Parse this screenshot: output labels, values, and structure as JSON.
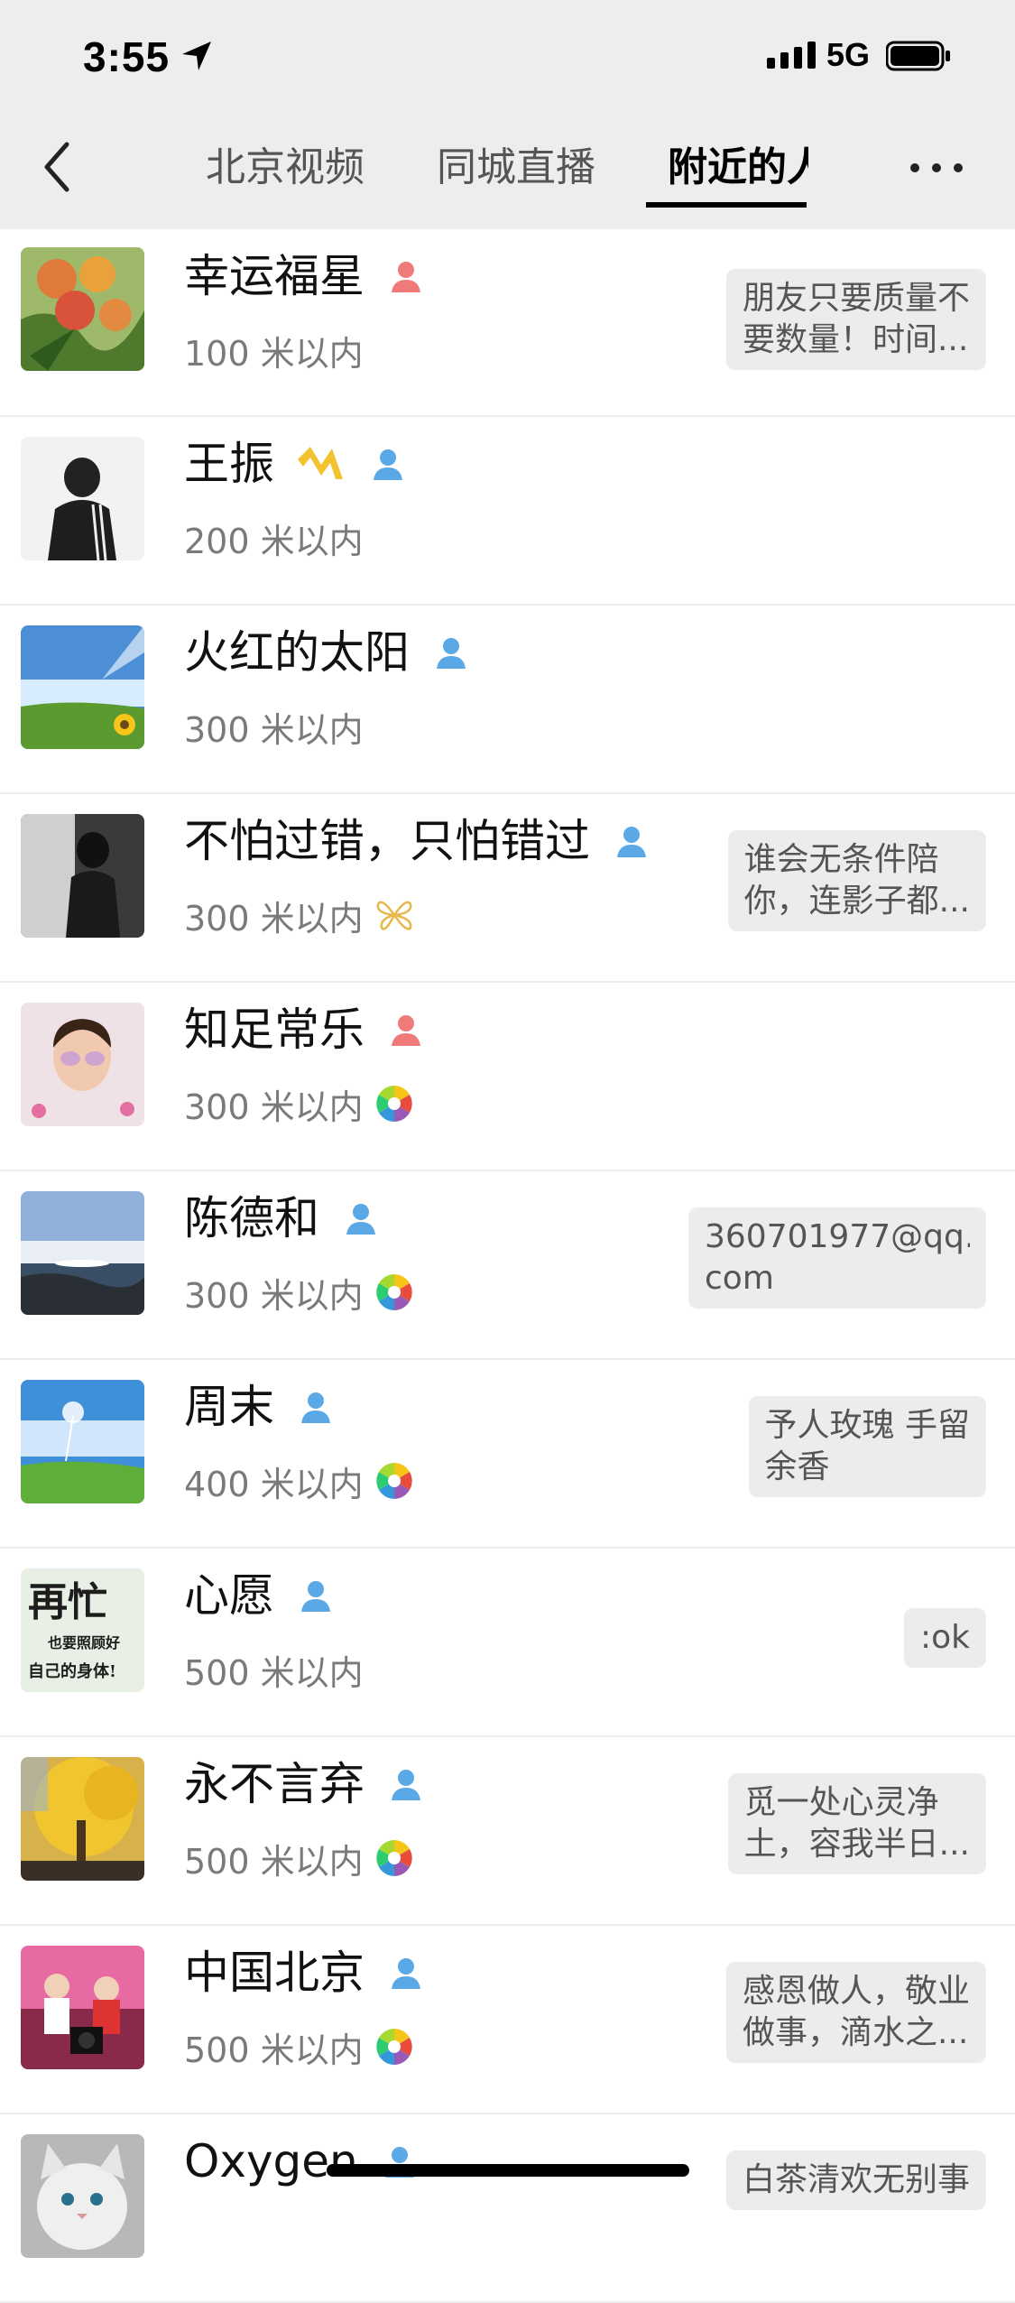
{
  "status": {
    "time": "3:55",
    "network": "5G"
  },
  "nav": {
    "tabs": [
      {
        "label": "北京视频"
      },
      {
        "label": "同城直播"
      },
      {
        "label": "附近的人"
      }
    ]
  },
  "people": [
    {
      "name": "幸运福星",
      "gender": "female",
      "distance": "100 米以内",
      "signature": [
        "朋友只要质量不",
        "要数量！时间..."
      ]
    },
    {
      "name": "王振",
      "gender": "male",
      "crown": true,
      "distance": "200 米以内",
      "signature": []
    },
    {
      "name": "火红的太阳",
      "gender": "male",
      "distance": "300 米以内",
      "signature": []
    },
    {
      "name": "不怕过错，只怕错过",
      "gender": "male",
      "distance": "300 米以内",
      "extra_icon": "butterfly-icon",
      "signature": [
        "谁会无条件陪",
        "你，连影子都..."
      ]
    },
    {
      "name": "知足常乐",
      "gender": "female",
      "distance": "300 米以内",
      "extra_icon": "moments-icon",
      "signature": []
    },
    {
      "name": "陈德和",
      "gender": "male",
      "distance": "300 米以内",
      "extra_icon": "moments-icon",
      "signature": [
        "360701977@qq.",
        "com"
      ]
    },
    {
      "name": "周末",
      "gender": "male",
      "distance": "400 米以内",
      "extra_icon": "moments-icon",
      "signature": [
        "予人玫瑰 手留",
        "余香"
      ]
    },
    {
      "name": "心愿",
      "gender": "male",
      "distance": "500 米以内",
      "signature": [
        ":ok"
      ]
    },
    {
      "name": "永不言弃",
      "gender": "male",
      "distance": "500 米以内",
      "extra_icon": "moments-icon",
      "signature": [
        "觅一处心灵净",
        "土，容我半日..."
      ]
    },
    {
      "name": "中国北京",
      "gender": "male",
      "distance": "500 米以内",
      "extra_icon": "moments-icon",
      "signature": [
        "感恩做人，敬业",
        "做事，滴水之..."
      ]
    },
    {
      "name": "Oxygen",
      "gender": "male",
      "distance": "",
      "signature": [
        "白茶清欢无别事"
      ]
    }
  ],
  "colors": {
    "male": "#5aa9e6",
    "female": "#f07a7a",
    "header_bg": "#ededed"
  }
}
